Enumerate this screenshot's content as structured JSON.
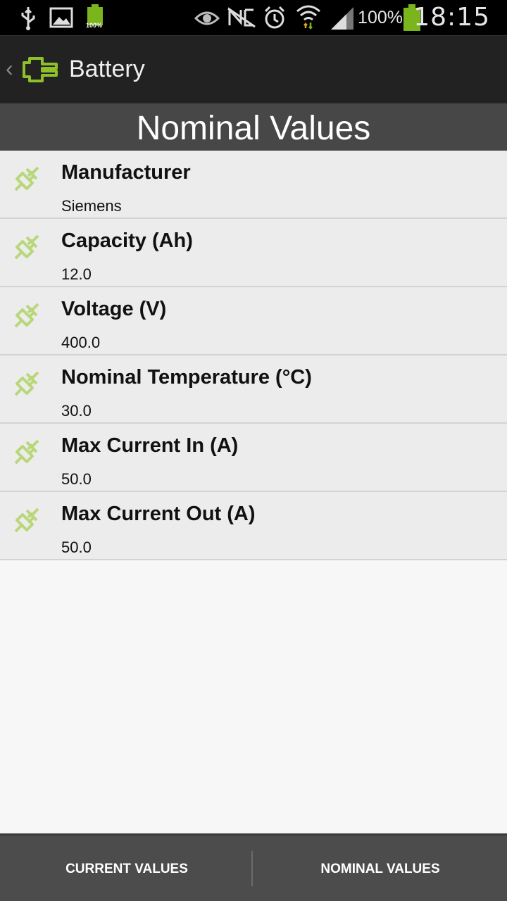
{
  "status_bar": {
    "battery_small_pct": "100%",
    "battery_pct": "100%",
    "time": "18:15",
    "icons": [
      "usb-icon",
      "image-icon",
      "battery-small-icon",
      "eye-icon",
      "nfc-icon",
      "alarm-icon",
      "wifi-icon",
      "signal-icon",
      "battery-icon"
    ]
  },
  "action_bar": {
    "title": "Battery",
    "icons": [
      "back-chevron-icon",
      "battery-plug-icon"
    ]
  },
  "section": {
    "title": "Nominal Values"
  },
  "items": [
    {
      "label": "Manufacturer",
      "value": "Siemens"
    },
    {
      "label": "Capacity (Ah)",
      "value": "12.0"
    },
    {
      "label": "Voltage (V)",
      "value": "400.0"
    },
    {
      "label": "Nominal Temperature (°C)",
      "value": "30.0"
    },
    {
      "label": "Max Current In (A)",
      "value": "50.0"
    },
    {
      "label": "Max Current Out (A)",
      "value": "50.0"
    }
  ],
  "tabs": {
    "current": "CURRENT VALUES",
    "nominal": "NOMINAL VALUES"
  },
  "colors": {
    "accent_green": "#8fbf2a",
    "icon_green": "#b9d77a"
  }
}
